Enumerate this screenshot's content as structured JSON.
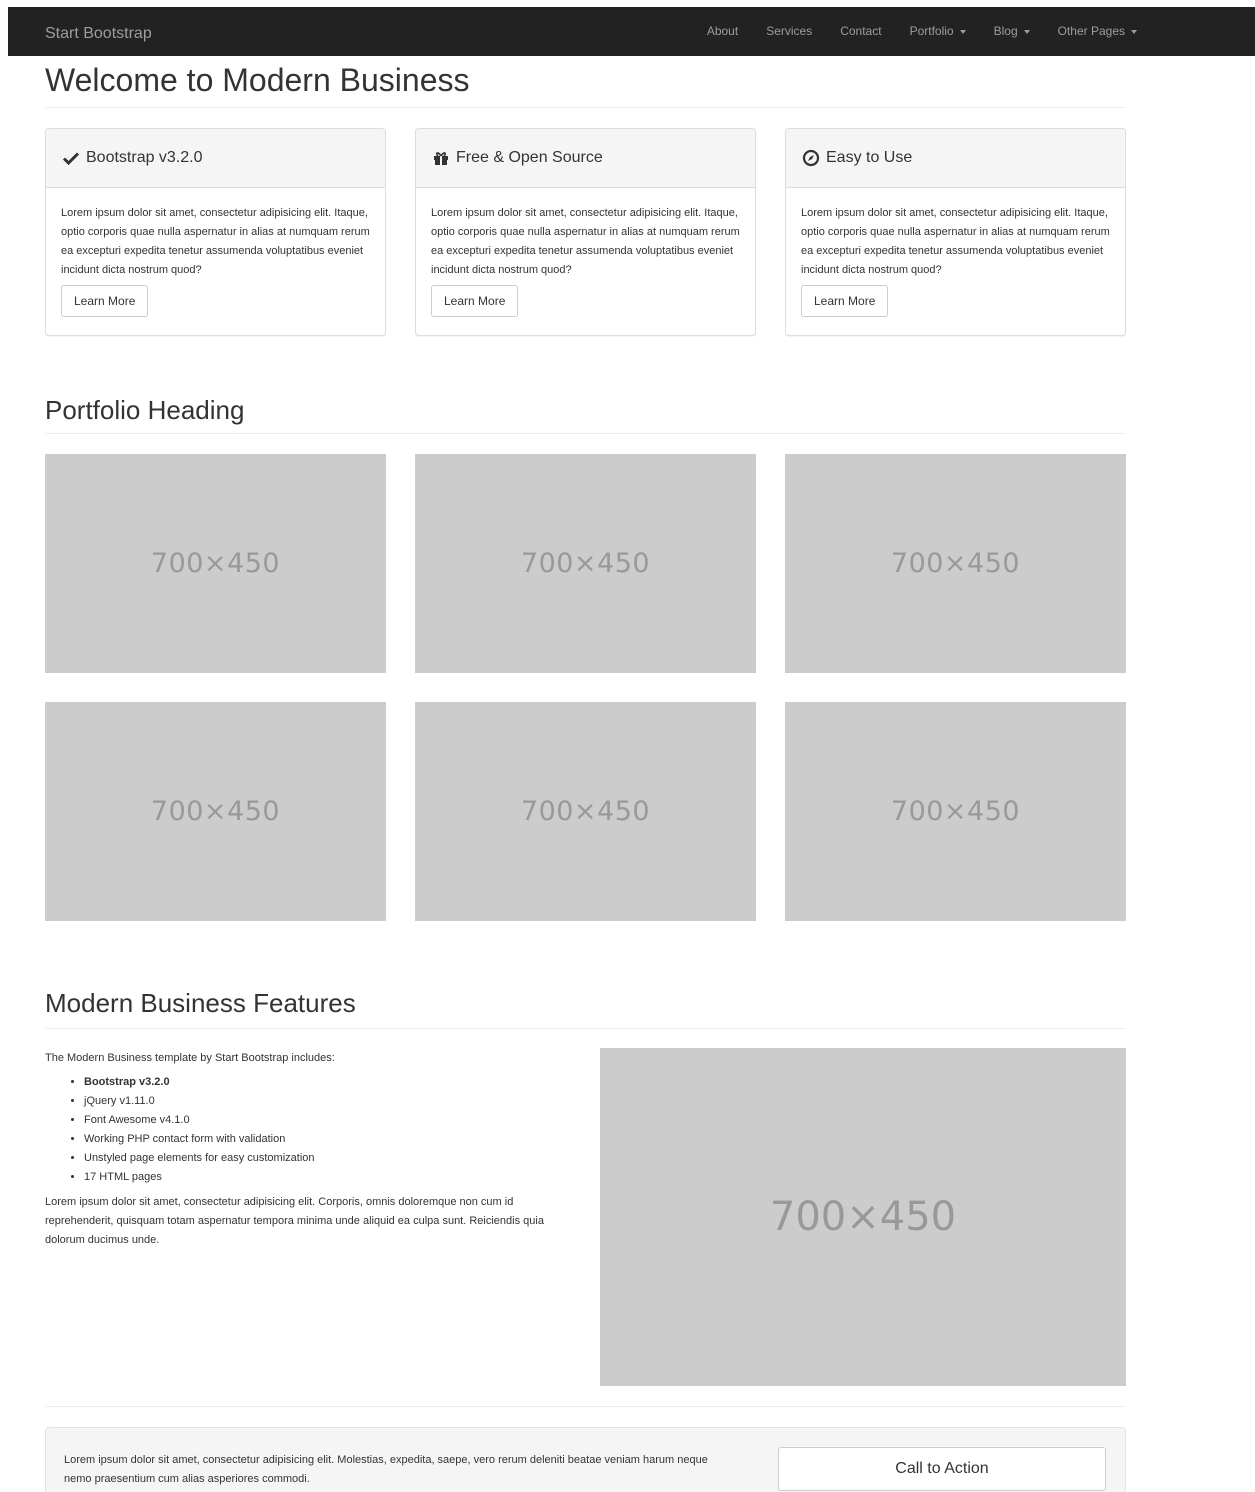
{
  "navbar": {
    "brand": "Start Bootstrap",
    "items": [
      {
        "label": "About",
        "dropdown": false
      },
      {
        "label": "Services",
        "dropdown": false
      },
      {
        "label": "Contact",
        "dropdown": false
      },
      {
        "label": "Portfolio",
        "dropdown": true
      },
      {
        "label": "Blog",
        "dropdown": true
      },
      {
        "label": "Other Pages",
        "dropdown": true
      }
    ]
  },
  "header": {
    "title": "Welcome to Modern Business"
  },
  "panels": [
    {
      "icon": "check-icon",
      "title": "Bootstrap v3.2.0",
      "body": "Lorem ipsum dolor sit amet, consectetur adipisicing elit. Itaque, optio corporis quae nulla aspernatur in alias at numquam rerum ea excepturi expedita tenetur assumenda voluptatibus eveniet incidunt dicta nostrum quod?",
      "button": "Learn More"
    },
    {
      "icon": "gift-icon",
      "title": "Free & Open Source",
      "body": "Lorem ipsum dolor sit amet, consectetur adipisicing elit. Itaque, optio corporis quae nulla aspernatur in alias at numquam rerum ea excepturi expedita tenetur assumenda voluptatibus eveniet incidunt dicta nostrum quod?",
      "button": "Learn More"
    },
    {
      "icon": "compass-icon",
      "title": "Easy to Use",
      "body": "Lorem ipsum dolor sit amet, consectetur adipisicing elit. Itaque, optio corporis quae nulla aspernatur in alias at numquam rerum ea excepturi expedita tenetur assumenda voluptatibus eveniet incidunt dicta nostrum quod?",
      "button": "Learn More"
    }
  ],
  "portfolio": {
    "heading": "Portfolio Heading",
    "placeholder": "700×450"
  },
  "features": {
    "heading": "Modern Business Features",
    "intro": "The Modern Business template by Start Bootstrap includes:",
    "items": [
      "Bootstrap v3.2.0",
      "jQuery v1.11.0",
      "Font Awesome v4.1.0",
      "Working PHP contact form with validation",
      "Unstyled page elements for easy customization",
      "17 HTML pages"
    ],
    "paragraph": "Lorem ipsum dolor sit amet, consectetur adipisicing elit. Corporis, omnis doloremque non cum id reprehenderit, quisquam totam aspernatur tempora minima unde aliquid ea culpa sunt. Reiciendis quia dolorum ducimus unde.",
    "image": "700×450"
  },
  "cta": {
    "text": "Lorem ipsum dolor sit amet, consectetur adipisicing elit. Molestias, expedita, saepe, vero rerum deleniti beatae veniam harum neque nemo praesentium cum alias asperiores commodi.",
    "button": "Call to Action"
  }
}
